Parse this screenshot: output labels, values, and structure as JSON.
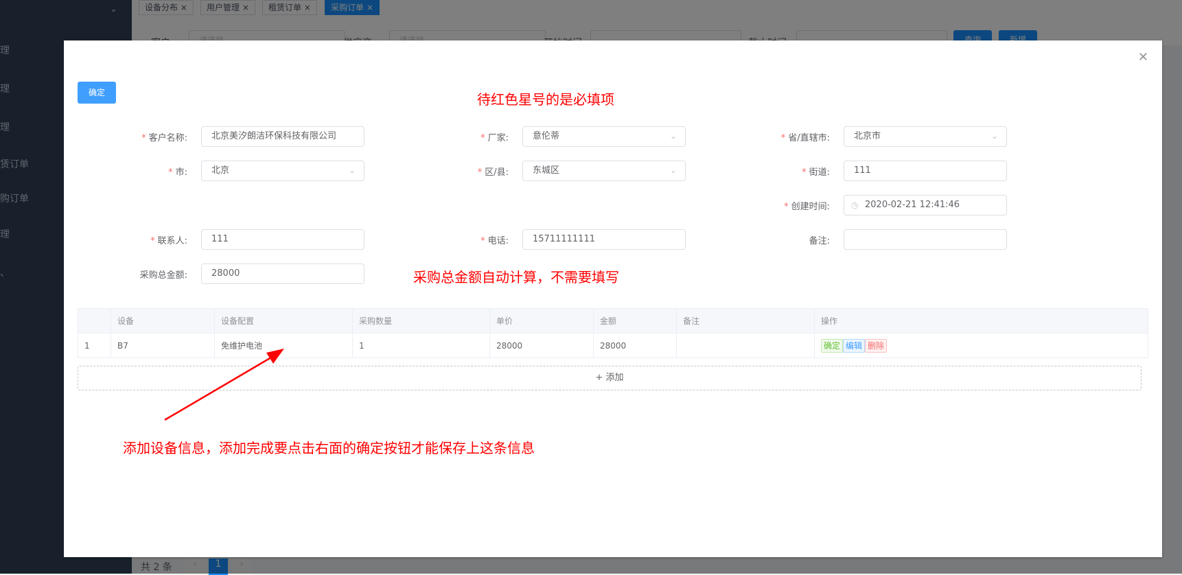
{
  "background": {
    "sidebar_items": [
      "理",
      "理",
      "理",
      "赁订单",
      "购订单",
      "理",
      "、"
    ],
    "tags": [
      "设备分布",
      "用户管理",
      "租赁订单",
      "采购订单"
    ],
    "filter_labels": [
      "客户:",
      "供应商:",
      "开始时间",
      "截止时间"
    ],
    "filter_placeholders": [
      "请选择",
      "请选择"
    ],
    "buttons": [
      "查询",
      "新增"
    ],
    "pager_total": "共 2 条",
    "pager_current": "1"
  },
  "dialog": {
    "confirm_label": "确定",
    "notes": {
      "required": "待红色星号的是必填项",
      "auto_calc": "采购总金额自动计算，不需要填写",
      "add_info": "添加设备信息，添加完成要点击右面的确定按钮才能保存上这条信息"
    },
    "form": {
      "customer": {
        "label": "客户名称:",
        "value": "北京美汐朗洁环保科技有限公司"
      },
      "manufacturer": {
        "label": "厂家:",
        "value": "意伦蒂"
      },
      "province": {
        "label": "省/直辖市:",
        "value": "北京市"
      },
      "city": {
        "label": "市:",
        "value": "北京"
      },
      "district": {
        "label": "区/县:",
        "value": "东城区"
      },
      "street": {
        "label": "街道:",
        "value": "111"
      },
      "created_time": {
        "label": "创建时间:",
        "value": "2020-02-21 12:41:46"
      },
      "contact": {
        "label": "联系人:",
        "value": "111"
      },
      "phone": {
        "label": "电话:",
        "value": "15711111111"
      },
      "remark": {
        "label": "备注:",
        "value": ""
      },
      "total": {
        "label": "采购总金额:",
        "value": "28000"
      }
    },
    "table": {
      "headers": [
        "",
        "设备",
        "设备配置",
        "采购数量",
        "单价",
        "金额",
        "备注",
        "操作"
      ],
      "rows": [
        {
          "index": "1",
          "device": "B7",
          "config": "免维护电池",
          "qty": "1",
          "price": "28000",
          "amount": "28000",
          "remark": ""
        }
      ],
      "ops": {
        "confirm": "确定",
        "edit": "编辑",
        "delete": "删除"
      }
    },
    "add_label": "+ 添加"
  }
}
